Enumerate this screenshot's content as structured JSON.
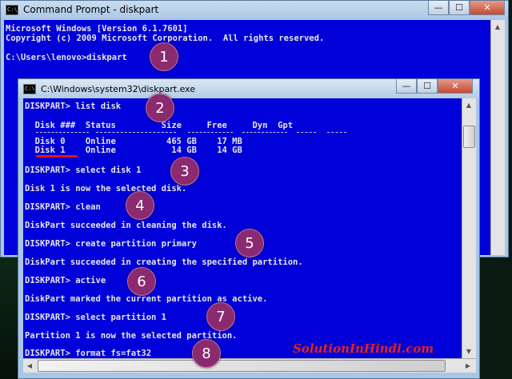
{
  "window_main": {
    "title": "Command Prompt - diskpart",
    "icon": "cmd-icon",
    "lines": [
      "Microsoft Windows [Version 6.1.7601]",
      "Copyright (c) 2009 Microsoft Corporation.  All rights reserved.",
      "C:\\Users\\lenovo>diskpart"
    ]
  },
  "window_diskpart": {
    "title": "C:\\Windows\\system32\\diskpart.exe",
    "lines": {
      "cmd_list_disk": "DISKPART> list disk",
      "table_header": "  Disk ###  Status         Size     Free     Dyn  Gpt",
      "row_disk0": "  Disk 0    Online          465 GB    17 MB",
      "row_disk1": "  Disk 1    Online           14 GB    14 GB",
      "cmd_select_disk": "DISKPART> select disk 1",
      "msg_select_disk": "Disk 1 is now the selected disk.",
      "cmd_clean": "DISKPART> clean",
      "msg_clean": "DiskPart succeeded in cleaning the disk.",
      "cmd_create": "DISKPART> create partition primary",
      "msg_create": "DiskPart succeeded in creating the specified partition.",
      "cmd_active": "DISKPART> active",
      "msg_active": "DiskPart marked the current partition as active.",
      "cmd_select_partition": "DISKPART> select partition 1",
      "msg_select_partition": "Partition 1 is now the selected partition.",
      "cmd_format": "DISKPART> format fs=fat32"
    }
  },
  "window_controls": {
    "minimize": "—",
    "maximize": "☐",
    "close": "✕"
  },
  "steps": [
    "1",
    "2",
    "3",
    "4",
    "5",
    "6",
    "7",
    "8"
  ],
  "watermark": "SolutionInHindi.com",
  "colors": {
    "console_bg": "#0000d8",
    "console_text": "#e6e6e6",
    "step_circle": "#8b2a6e",
    "highlight": "#e11111"
  }
}
